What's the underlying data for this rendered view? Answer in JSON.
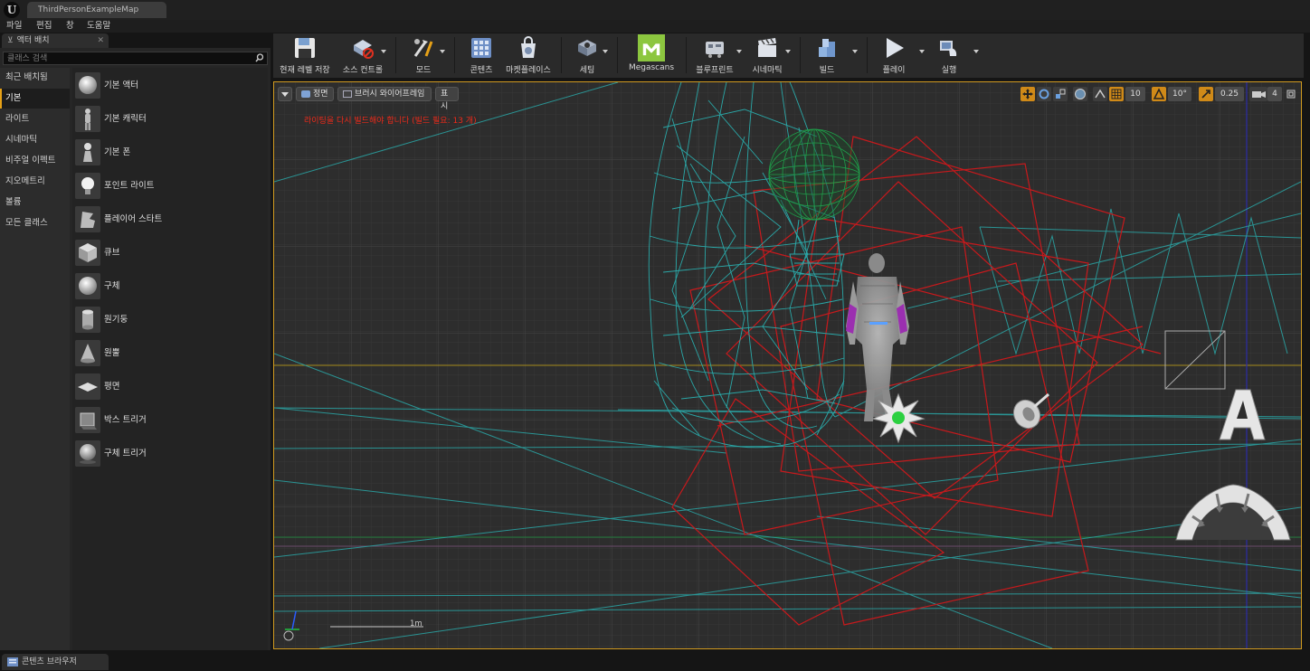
{
  "window": {
    "document_tab": "ThirdPersonExampleMap"
  },
  "menu": [
    {
      "label": "파일"
    },
    {
      "label": "편집"
    },
    {
      "label": "창"
    },
    {
      "label": "도움말"
    }
  ],
  "place_panel": {
    "tab_label": "액터 배치",
    "search_placeholder": "클래스 검색",
    "categories": [
      {
        "label": "최근 배치됨",
        "active": false
      },
      {
        "label": "기본",
        "active": true
      },
      {
        "label": "라이트",
        "active": false
      },
      {
        "label": "시네마틱",
        "active": false
      },
      {
        "label": "비주얼 이펙트",
        "active": false
      },
      {
        "label": "지오메트리",
        "active": false
      },
      {
        "label": "볼륨",
        "active": false
      },
      {
        "label": "모든 클래스",
        "active": false
      }
    ],
    "items": [
      {
        "label": "기본 액터",
        "icon": "sphere-icon"
      },
      {
        "label": "기본 캐릭터",
        "icon": "character-icon"
      },
      {
        "label": "기본 폰",
        "icon": "pawn-icon"
      },
      {
        "label": "포인트 라이트",
        "icon": "light-bulb-icon"
      },
      {
        "label": "플레이어 스타트",
        "icon": "player-start-icon"
      },
      {
        "label": "큐브",
        "icon": "cube-icon"
      },
      {
        "label": "구체",
        "icon": "sphere-icon"
      },
      {
        "label": "원기둥",
        "icon": "cylinder-icon"
      },
      {
        "label": "원뿔",
        "icon": "cone-icon"
      },
      {
        "label": "평면",
        "icon": "plane-icon"
      },
      {
        "label": "박스 트리거",
        "icon": "box-trigger-icon"
      },
      {
        "label": "구체 트리거",
        "icon": "sphere-trigger-icon"
      }
    ]
  },
  "toolbar": {
    "buttons": [
      {
        "label": "현재 레벨 저장",
        "icon": "save-icon"
      },
      {
        "label": "소스 컨트롤",
        "icon": "source-control-icon"
      },
      {
        "label": "모드",
        "icon": "modes-icon"
      },
      {
        "label": "콘텐츠",
        "icon": "content-icon"
      },
      {
        "label": "마켓플레이스",
        "icon": "marketplace-icon"
      },
      {
        "label": "세팅",
        "icon": "settings-icon"
      },
      {
        "label": "Megascans",
        "icon": "megascans-icon"
      },
      {
        "label": "블루프린트",
        "icon": "blueprint-icon"
      },
      {
        "label": "시네마틱",
        "icon": "cinematics-icon"
      },
      {
        "label": "빌드",
        "icon": "build-icon"
      },
      {
        "label": "플레이",
        "icon": "play-icon"
      },
      {
        "label": "실행",
        "icon": "launch-icon"
      }
    ]
  },
  "viewport": {
    "view_mode": "정면",
    "render_mode": "브러시 와이어프레임",
    "show_label": "표시",
    "lighting_warning": "라이팅을 다시 빌드해야 합니다 (빌드 필요: 13 개)",
    "grid_snap": "10",
    "rotation_snap": "10°",
    "scale_snap": "0.25",
    "camera_speed": "4",
    "scale_label": "1m"
  },
  "content_browser": {
    "tab_label": "콘텐츠 브라우저"
  },
  "colors": {
    "accent": "#e6a117",
    "warning": "#ee2a1a",
    "wire_cyan": "#2aa7a7",
    "wire_red": "#c8191c",
    "wire_green": "#1f9f4a"
  }
}
